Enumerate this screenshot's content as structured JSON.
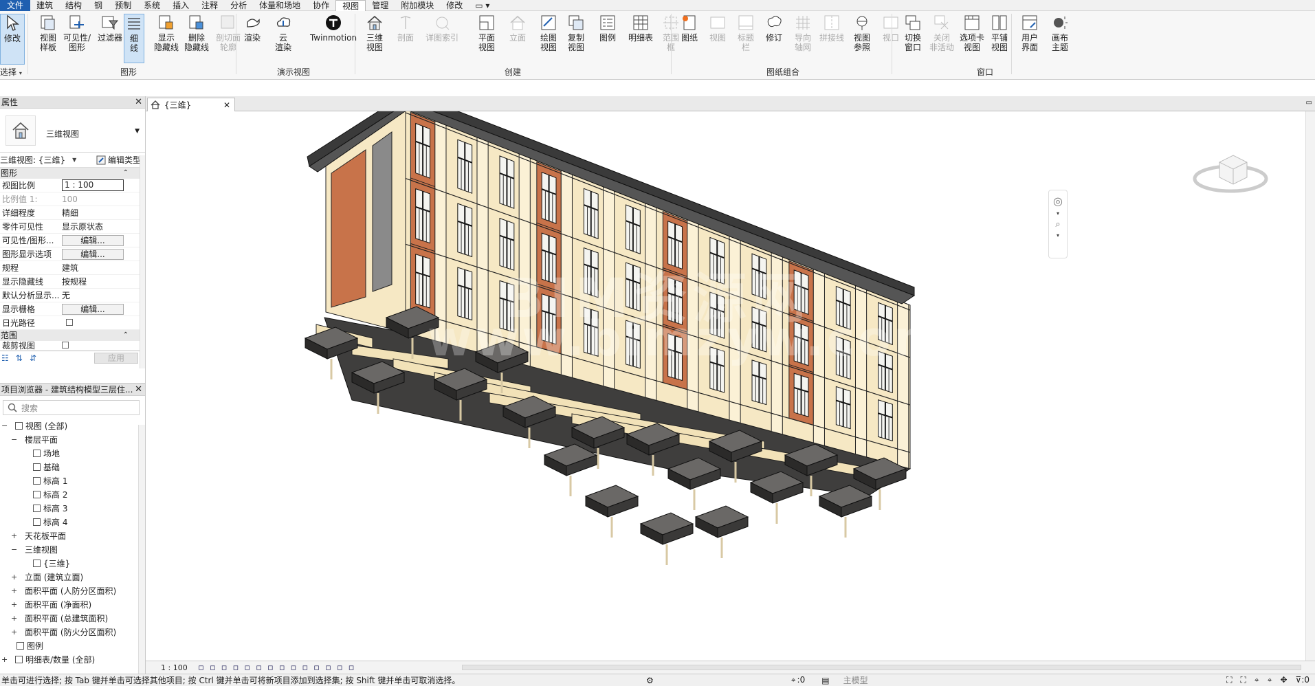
{
  "menu": {
    "tabs": [
      "文件",
      "建筑",
      "结构",
      "钢",
      "预制",
      "系统",
      "插入",
      "注释",
      "分析",
      "体量和场地",
      "协作",
      "视图",
      "管理",
      "附加模块",
      "修改"
    ],
    "active": "视图"
  },
  "ribbon": {
    "select": {
      "modify_label": "修改",
      "select_label": "选择"
    },
    "graphics_panel": "图形",
    "present_panel": "演示视图",
    "create_panel": "创建",
    "sheet_panel": "图纸组合",
    "window_panel": "窗口",
    "tools": [
      {
        "label": "视图\n样板"
      },
      {
        "label": "可见性/\n图形"
      },
      {
        "label": "过滤器"
      },
      {
        "label": "细\n线"
      },
      {
        "label": "显示\n隐藏线"
      },
      {
        "label": "删除\n隐藏线"
      },
      {
        "label": "剖切面\n轮廓"
      },
      {
        "label": "渲染"
      },
      {
        "label": "云\n渲染"
      },
      {
        "label": "Twinmotion"
      },
      {
        "label": "三维\n视图"
      },
      {
        "label": "剖面"
      },
      {
        "label": "详图索引"
      },
      {
        "label": "平面\n视图"
      },
      {
        "label": "立面"
      },
      {
        "label": "绘图\n视图"
      },
      {
        "label": "复制\n视图"
      },
      {
        "label": "图例"
      },
      {
        "label": "明细表"
      },
      {
        "label": "范围\n框"
      },
      {
        "label": "图纸"
      },
      {
        "label": "视图"
      },
      {
        "label": "标题\n栏"
      },
      {
        "label": "修订"
      },
      {
        "label": "导向\n轴网"
      },
      {
        "label": "拼接线"
      },
      {
        "label": "视图\n参照"
      },
      {
        "label": "视口"
      },
      {
        "label": "切换\n窗口"
      },
      {
        "label": "关闭\n非活动"
      },
      {
        "label": "选项卡\n视图"
      },
      {
        "label": "平铺\n视图"
      },
      {
        "label": "用户\n界面"
      },
      {
        "label": "画布\n主题"
      }
    ]
  },
  "properties": {
    "title": "属性",
    "type_name": "三维视图",
    "view_selector": "三维视图: {三维}",
    "edit_type": "编辑类型",
    "group_graphics": "图形",
    "rows": [
      {
        "k": "视图比例",
        "v": "1 : 100",
        "kind": "input"
      },
      {
        "k": "比例值 1:",
        "v": "100",
        "kind": "gray"
      },
      {
        "k": "详细程度",
        "v": "精细"
      },
      {
        "k": "零件可见性",
        "v": "显示原状态"
      },
      {
        "k": "可见性/图形...",
        "v": "编辑...",
        "kind": "btn"
      },
      {
        "k": "图形显示选项",
        "v": "编辑...",
        "kind": "btn"
      },
      {
        "k": "规程",
        "v": "建筑"
      },
      {
        "k": "显示隐藏线",
        "v": "按规程"
      },
      {
        "k": "默认分析显示...",
        "v": "无"
      },
      {
        "k": "显示栅格",
        "v": "编辑...",
        "kind": "btn"
      },
      {
        "k": "日光路径",
        "v": "",
        "kind": "check"
      }
    ],
    "group_extents": "范围",
    "crop_row": "裁剪视图",
    "apply": "应用"
  },
  "browser": {
    "title": "项目浏览器 - 建筑结构模型三层住...",
    "search_placeholder": "搜索",
    "items": [
      {
        "label": "视图 (全部)",
        "level": 0,
        "pm": "−",
        "icon": true
      },
      {
        "label": "楼层平面",
        "level": 1,
        "pm": "−"
      },
      {
        "label": "场地",
        "level": 2,
        "icon": true
      },
      {
        "label": "基础",
        "level": 2,
        "icon": true
      },
      {
        "label": "标高 1",
        "level": 2,
        "icon": true
      },
      {
        "label": "标高 2",
        "level": 2,
        "icon": true
      },
      {
        "label": "标高 3",
        "level": 2,
        "icon": true
      },
      {
        "label": "标高 4",
        "level": 2,
        "icon": true
      },
      {
        "label": "天花板平面",
        "level": 1,
        "pm": "+"
      },
      {
        "label": "三维视图",
        "level": 1,
        "pm": "−"
      },
      {
        "label": "{三维}",
        "level": 2,
        "icon": true
      },
      {
        "label": "立面 (建筑立面)",
        "level": 1,
        "pm": "+"
      },
      {
        "label": "面积平面 (人防分区面积)",
        "level": 1,
        "pm": "+"
      },
      {
        "label": "面积平面 (净面积)",
        "level": 1,
        "pm": "+"
      },
      {
        "label": "面积平面 (总建筑面积)",
        "level": 1,
        "pm": "+"
      },
      {
        "label": "面积平面 (防火分区面积)",
        "level": 1,
        "pm": "+"
      },
      {
        "label": "图例",
        "level": 0,
        "icon": true
      },
      {
        "label": "明细表/数量 (全部)",
        "level": 0,
        "pm": "+",
        "icon": true
      }
    ]
  },
  "view_tab": {
    "label": "{三维}"
  },
  "view_control": {
    "scale": "1 : 100"
  },
  "watermark": {
    "line1": "BIM资源网",
    "line2": "www.bimzyw.com"
  },
  "status": {
    "text": "单击可进行选择; 按 Tab 键并单击可选择其他项目; 按 Ctrl 键并单击可将新项目添加到选择集; 按 Shift 键并单击可取消选择。",
    "sel_count": ":0",
    "model": "主模型",
    "filter_count": ":0"
  },
  "colors": {
    "accent": "#1f5fb0",
    "wall_cream": "#f6e8c4",
    "panel_brick": "#c8734a",
    "roof": "#3a3a3a",
    "slab": "#4a4848"
  }
}
